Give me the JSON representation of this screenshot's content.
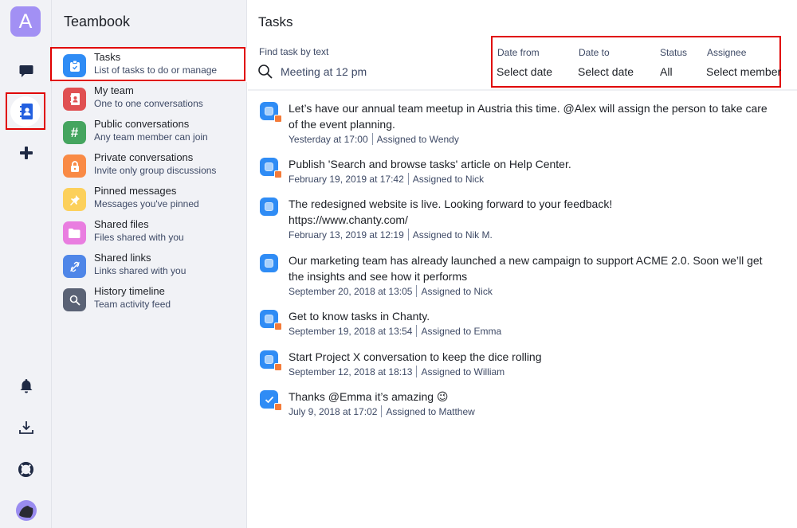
{
  "rail": {
    "workspace_initial": "A",
    "icons": [
      "chat-icon",
      "teambook-icon",
      "add-icon",
      "bell-icon",
      "download-icon",
      "help-icon",
      "avatar"
    ]
  },
  "sidebar": {
    "title": "Teambook",
    "items": [
      {
        "label": "Tasks",
        "subtitle": "List of tasks to do or manage",
        "color": "#2f8cf5",
        "icon": "clipboard-icon",
        "active": true
      },
      {
        "label": "My team",
        "subtitle": "One to one conversations",
        "color": "#e05052",
        "icon": "contacts-icon"
      },
      {
        "label": "Public conversations",
        "subtitle": "Any team member can join",
        "color": "#45a55f",
        "icon": "hash-icon"
      },
      {
        "label": "Private conversations",
        "subtitle": "Invite only group discussions",
        "color": "#f98a45",
        "icon": "lock-icon"
      },
      {
        "label": "Pinned messages",
        "subtitle": "Messages you've pinned",
        "color": "#fcd05b",
        "icon": "pin-icon"
      },
      {
        "label": "Shared files",
        "subtitle": "Files shared with you",
        "color": "#e97de0",
        "icon": "folder-icon"
      },
      {
        "label": "Shared links",
        "subtitle": "Links shared with you",
        "color": "#4f86e8",
        "icon": "link-icon"
      },
      {
        "label": "History timeline",
        "subtitle": "Team activity feed",
        "color": "#5a6275",
        "icon": "search-icon"
      }
    ]
  },
  "main": {
    "title": "Tasks",
    "search": {
      "label": "Find task by text",
      "value": "Meeting at 12 pm"
    },
    "filters": [
      {
        "label": "Date from",
        "value": "Select date"
      },
      {
        "label": "Date to",
        "value": "Select date"
      },
      {
        "label": "Status",
        "value": "All"
      },
      {
        "label": "Assignee",
        "value": "Select member"
      }
    ],
    "tasks": [
      {
        "text": "Let’s have our annual team meetup in Austria this time. @Alex will assign the person to take care of the event planning.",
        "date": "Yesterday at 17:00",
        "assigned": "Assigned to  Wendy",
        "private": true,
        "done": false
      },
      {
        "text": "Publish 'Search and browse tasks' article on Help Center.",
        "date": "February 19, 2019 at 17:42",
        "assigned": "Assigned to  Nick",
        "private": true,
        "done": false
      },
      {
        "text": "The redesigned website is live. Looking forward to your feedback! https://www.chanty.com/",
        "date": "February 13, 2019 at 12:19",
        "assigned": "Assigned to  Nik M.",
        "private": false,
        "done": false
      },
      {
        "text": "Our marketing team has already launched a new campaign to support ACME 2.0. Soon we’ll get the insights and see how it performs",
        "date": "September 20, 2018 at 13:05",
        "assigned": "Assigned to  Nick",
        "private": false,
        "done": false
      },
      {
        "text": "Get to know tasks in Chanty.",
        "date": "September 19, 2018 at 13:54",
        "assigned": "Assigned to  Emma",
        "private": true,
        "done": false
      },
      {
        "text": "Start Project X conversation to keep the dice rolling",
        "date": "September 12, 2018 at 18:13",
        "assigned": "Assigned to  William",
        "private": true,
        "done": false
      },
      {
        "text": "Thanks @Emma it’s amazing 😉",
        "date": "July 9, 2018 at 17:02",
        "assigned": "Assigned to  Matthew",
        "private": true,
        "done": true
      }
    ]
  }
}
